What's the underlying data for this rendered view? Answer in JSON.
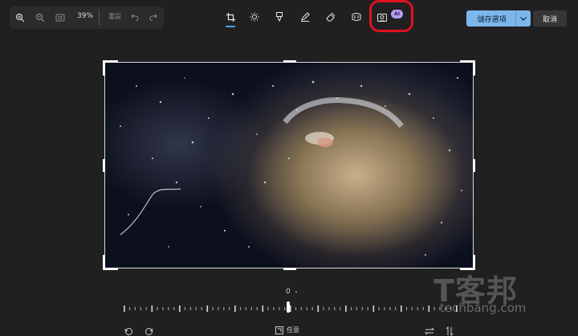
{
  "zoom": {
    "value": "39%",
    "reset_label": "重設"
  },
  "toolbar": {
    "tools": [
      "crop-tool",
      "brightness-tool",
      "filter-tool",
      "markup-tool",
      "erase-tool",
      "retouch-tool",
      "background-blur-tool"
    ],
    "ai_badge": "AI"
  },
  "actions": {
    "save_label": "儲存選項",
    "cancel_label": "取消"
  },
  "straighten": {
    "value": "0",
    "level": 0
  },
  "bottom": {
    "aspect_label": "任意"
  },
  "watermark": {
    "brand_cn": "T客邦",
    "brand_en": "techbang.com"
  },
  "colors": {
    "accent": "#4aa3e8",
    "save_button": "#7db6ec",
    "ai_badge": "#b89cf5",
    "highlight_ring": "#e01020"
  }
}
